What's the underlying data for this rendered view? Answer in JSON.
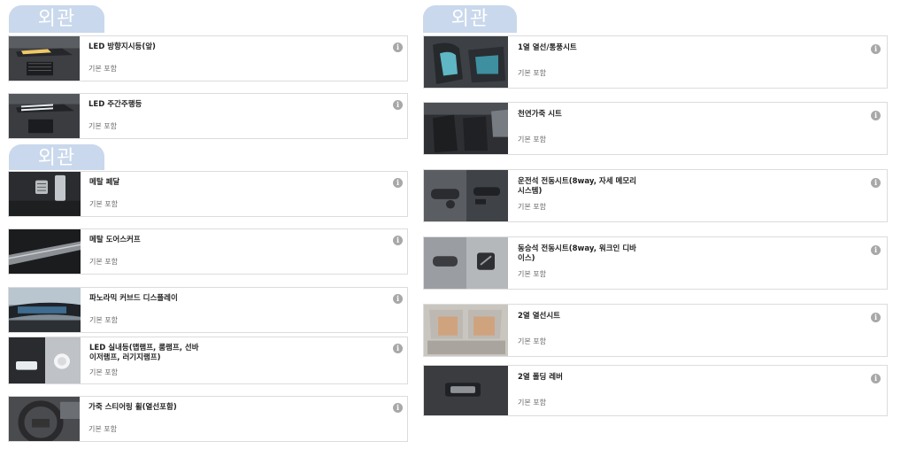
{
  "left_column": {
    "section1_tab": "외관",
    "section2_tab": "외관",
    "items": [
      {
        "title": "LED 방향지시등(앞)",
        "sub": "기본 포함",
        "info": "i"
      },
      {
        "title": "LED 주간주행등",
        "sub": "기본 포함",
        "info": "i"
      },
      {
        "title": "메탈 페달",
        "sub": "기본 포함",
        "info": "i"
      },
      {
        "title": "메탈 도어스커프",
        "sub": "기본 포함",
        "info": "i"
      },
      {
        "title": "파노라믹 커브드 디스플레이",
        "sub": "기본 포함",
        "info": "i"
      },
      {
        "title": "LED 실내등(맵램프, 룸램프, 선바이저램프, 러기지램프)",
        "sub": "기본 포함",
        "info": "i"
      },
      {
        "title": "가죽 스티어링 휠(열선포함)",
        "sub": "기본 포함",
        "info": "i"
      }
    ]
  },
  "right_column": {
    "section_tab": "외관",
    "items": [
      {
        "title": "1열 열선/통풍시트",
        "sub": "기본 포함",
        "info": "i"
      },
      {
        "title": "천연가죽 시트",
        "sub": "기본 포함",
        "info": "i"
      },
      {
        "title": "운전석 전동시트(8way, 자세 메모리 시스템)",
        "sub": "기본 포함",
        "info": "i"
      },
      {
        "title": "동승석 전동시트(8way, 워크인 디바이스)",
        "sub": "기본 포함",
        "info": "i"
      },
      {
        "title": "2열 열선시트",
        "sub": "기본 포함",
        "info": "i"
      },
      {
        "title": "2열 폴딩 레버",
        "sub": "기본 포함",
        "info": "i"
      }
    ]
  }
}
